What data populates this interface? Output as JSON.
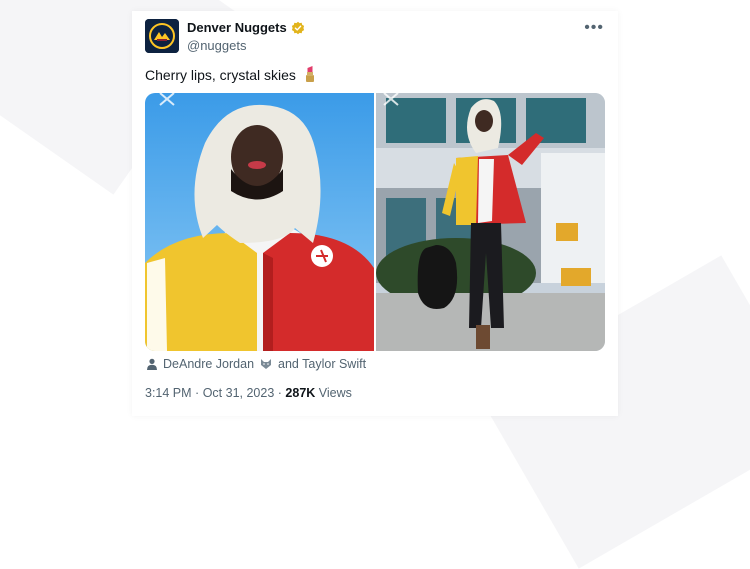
{
  "tweet": {
    "display_name": "Denver Nuggets",
    "handle": "@nuggets",
    "text": "Cherry lips, crystal skies",
    "more_label": "•••"
  },
  "tags": {
    "name1": "DeAndre Jordan",
    "connector": "and Taylor Swift"
  },
  "meta": {
    "time": "3:14 PM",
    "separator": "·",
    "date": "Oct 31, 2023",
    "separator2": "·",
    "views_count": "287K",
    "views_label": "Views"
  },
  "colors": {
    "verified": "#e2b41c",
    "chiefs_red": "#d42b2b",
    "chiefs_gold": "#f4c430",
    "nuggets_navy": "#0d2240"
  },
  "icons": [
    "nuggets-logo-icon",
    "verified-badge-icon",
    "more-icon",
    "lipstick-icon",
    "person-icon",
    "wolf-icon"
  ]
}
